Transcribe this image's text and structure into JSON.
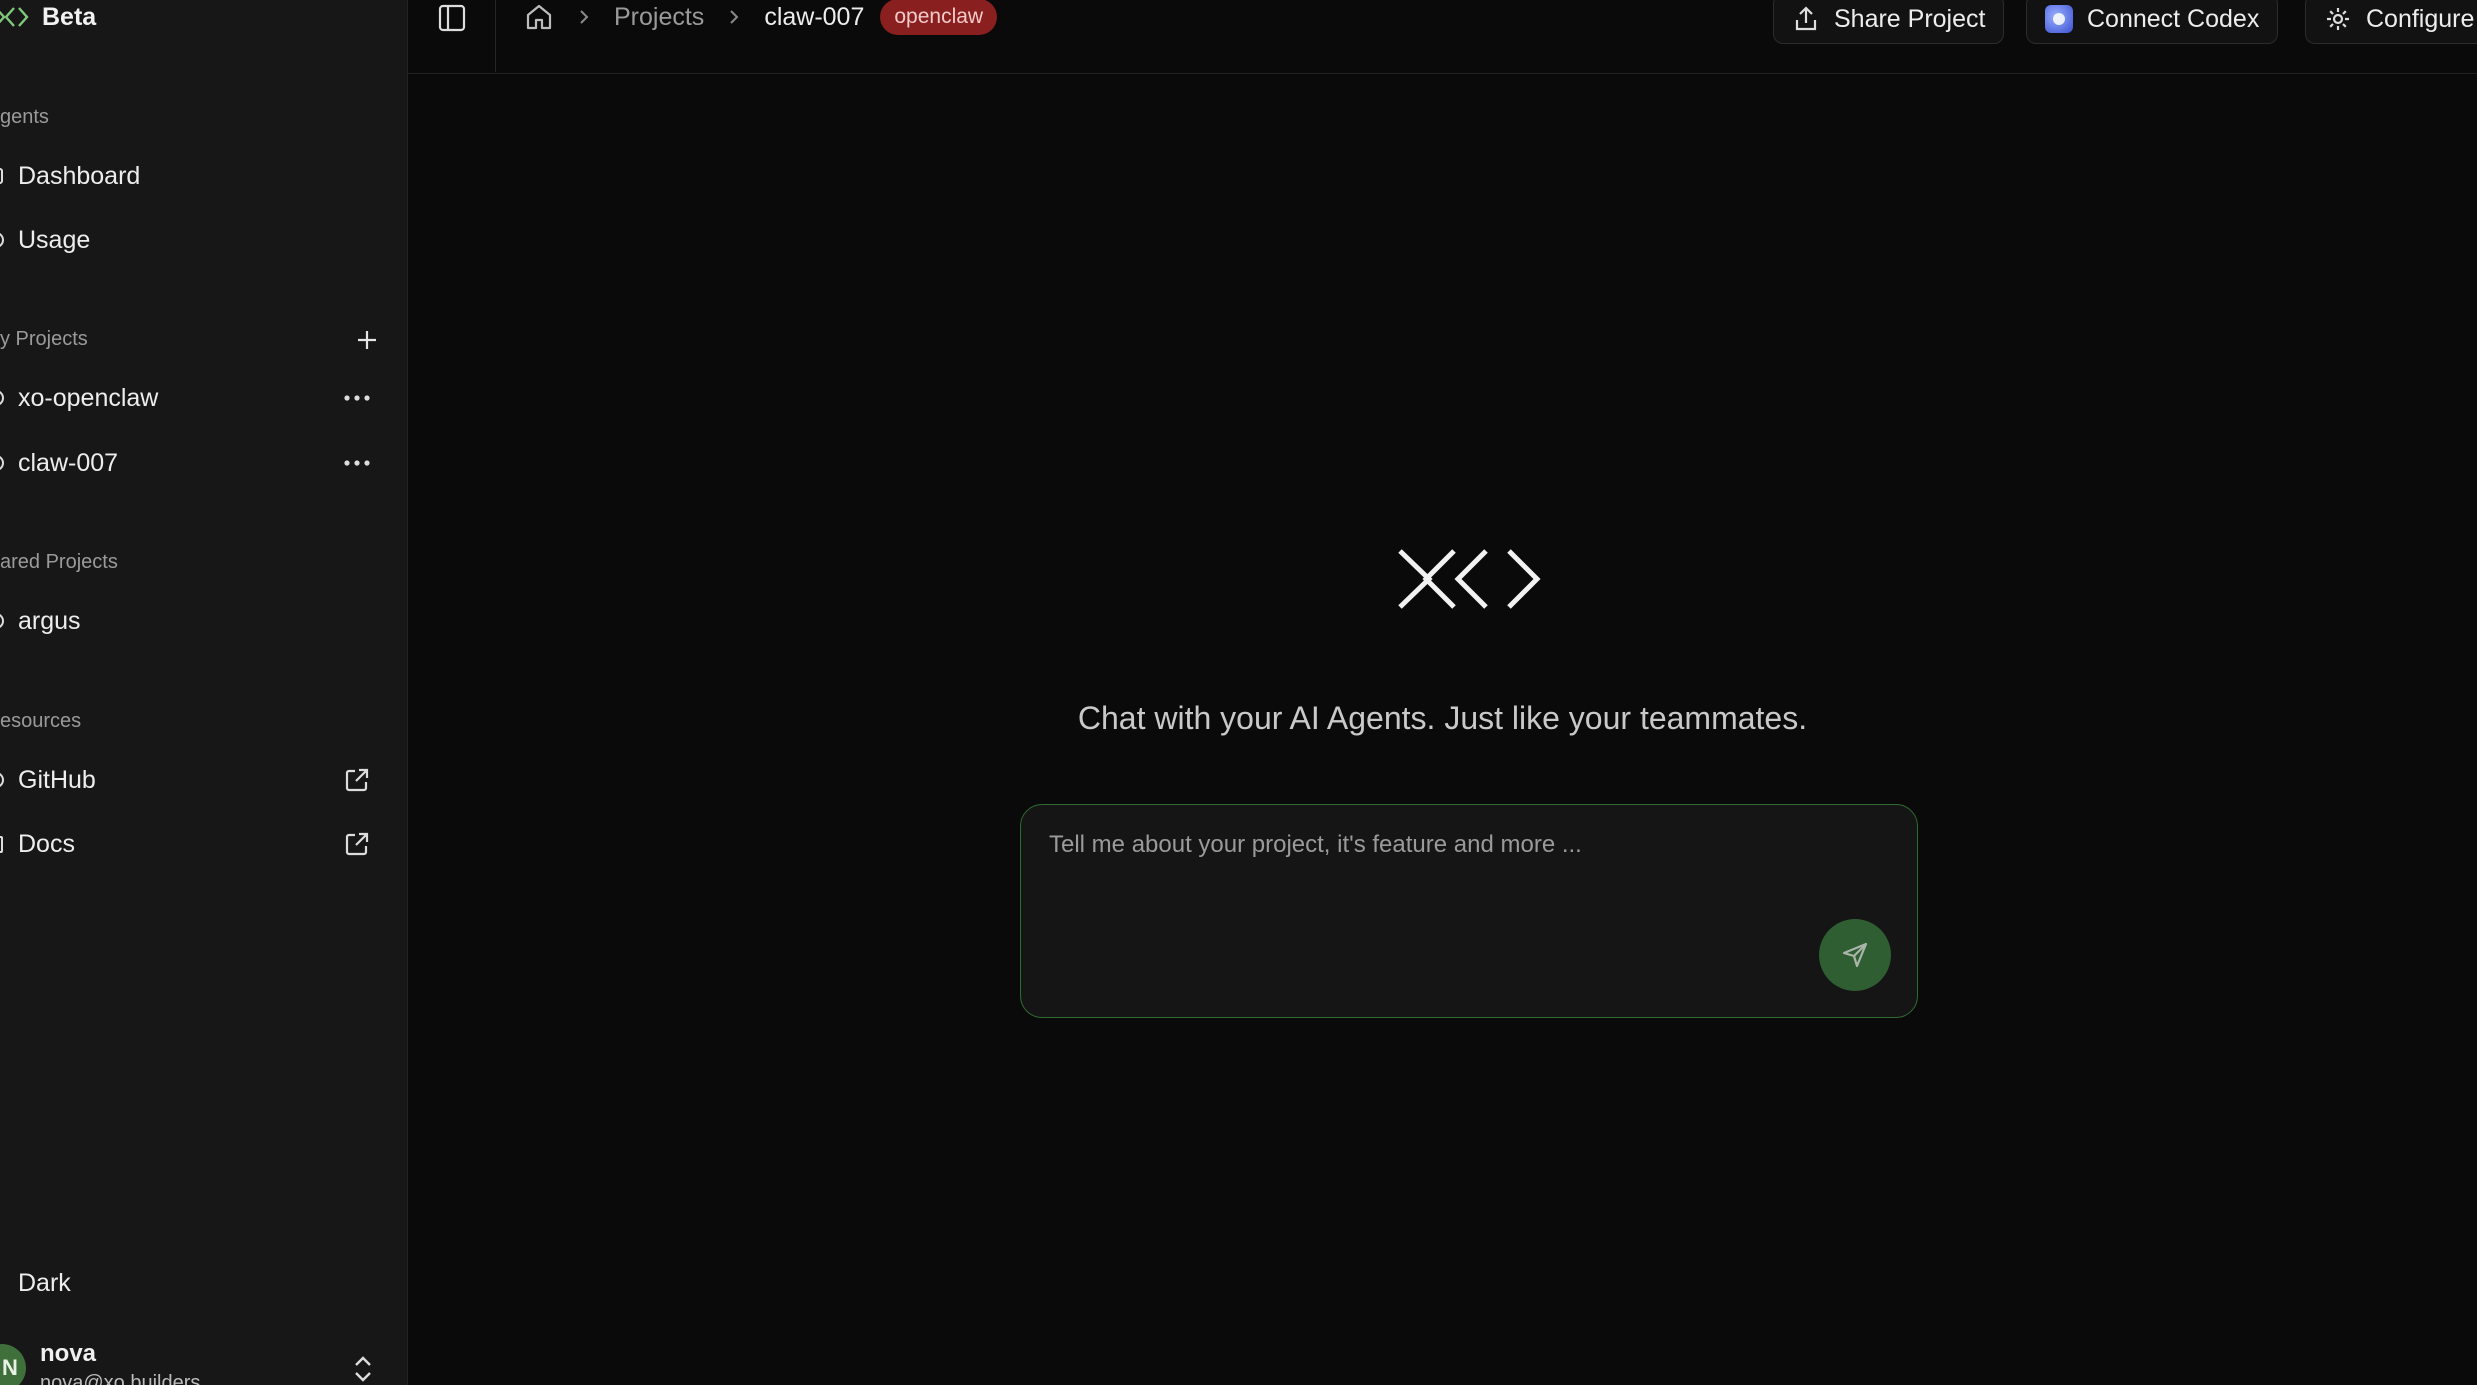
{
  "brand": {
    "name": "Beta",
    "logo": "xo-logo"
  },
  "header": {
    "breadcrumb": {
      "home_icon": "home-icon",
      "projects": "Projects",
      "current": "claw-007",
      "badge": "openclaw"
    },
    "share_label": "Share Project",
    "codex_label": "Connect Codex",
    "configure_label": "Configure"
  },
  "sidebar": {
    "agents_label": "gents",
    "agents": [
      {
        "label": "Dashboard",
        "icon": "dashboard-icon"
      },
      {
        "label": "Usage",
        "icon": "usage-icon"
      }
    ],
    "my_projects_label": "y Projects",
    "my_projects": [
      {
        "label": "xo-openclaw",
        "icon": "project-icon"
      },
      {
        "label": "claw-007",
        "icon": "project-icon"
      }
    ],
    "shared_label": "ared Projects",
    "shared_projects": [
      {
        "label": "argus",
        "icon": "project-icon"
      }
    ],
    "resources_label": "esources",
    "resources": [
      {
        "label": "GitHub",
        "icon": "github-icon"
      },
      {
        "label": "Docs",
        "icon": "docs-icon"
      }
    ],
    "theme_label": "Dark",
    "user": {
      "initial": "N",
      "name": "nova",
      "email": "nova@xo.builders"
    }
  },
  "main": {
    "tagline": "Chat with your AI Agents. Just like your teammates.",
    "composer_placeholder": "Tell me about your project, it's feature and more ..."
  },
  "colors": {
    "accent": "#2f6b33",
    "badge_bg": "#8a1f1f",
    "send_bg": "#2f5e32"
  }
}
